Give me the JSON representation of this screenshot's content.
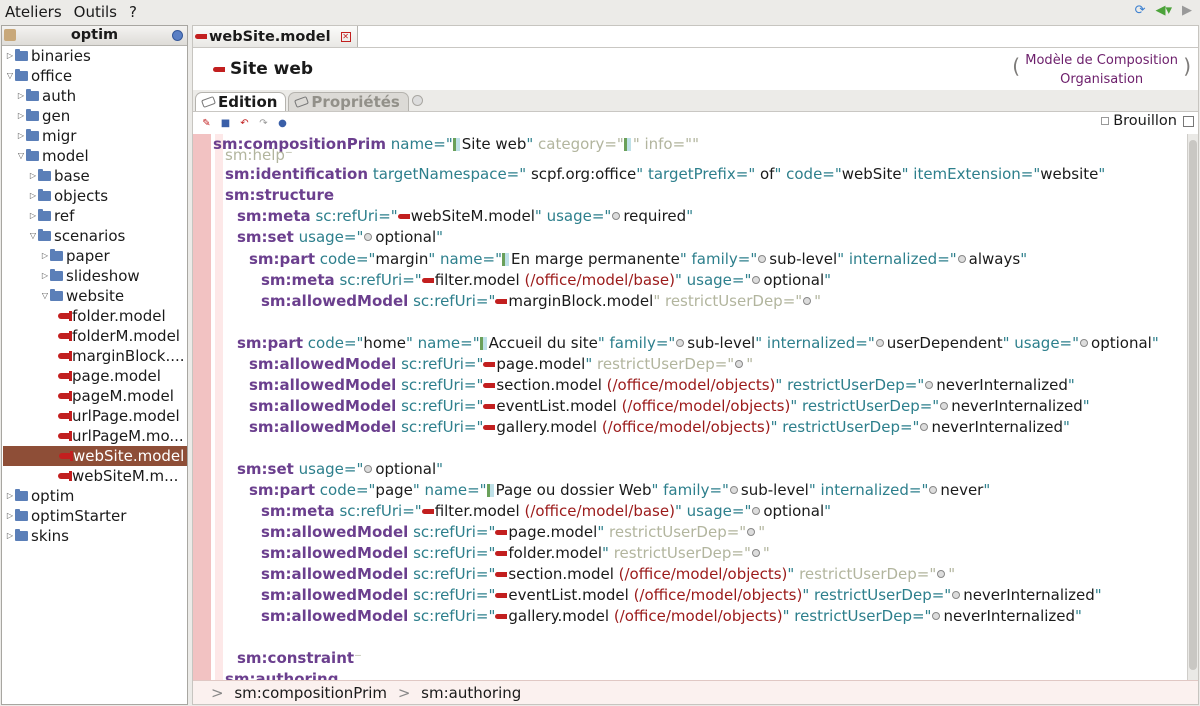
{
  "menu": [
    "Ateliers",
    "Outils",
    "?"
  ],
  "left_panel": {
    "title": "optim",
    "tree": [
      {
        "label": "binaries",
        "level": 0,
        "expanded": false,
        "kind": "folder"
      },
      {
        "label": "office",
        "level": 0,
        "expanded": true,
        "kind": "folder"
      },
      {
        "label": "auth",
        "level": 1,
        "expanded": false,
        "kind": "folder"
      },
      {
        "label": "gen",
        "level": 1,
        "expanded": false,
        "kind": "folder"
      },
      {
        "label": "migr",
        "level": 1,
        "expanded": false,
        "kind": "folder"
      },
      {
        "label": "model",
        "level": 1,
        "expanded": true,
        "kind": "folder"
      },
      {
        "label": "base",
        "level": 2,
        "expanded": false,
        "kind": "folder"
      },
      {
        "label": "objects",
        "level": 2,
        "expanded": false,
        "kind": "folder"
      },
      {
        "label": "ref",
        "level": 2,
        "expanded": false,
        "kind": "folder"
      },
      {
        "label": "scenarios",
        "level": 2,
        "expanded": true,
        "kind": "folder"
      },
      {
        "label": "paper",
        "level": 3,
        "expanded": false,
        "kind": "folder"
      },
      {
        "label": "slideshow",
        "level": 3,
        "expanded": false,
        "kind": "folder"
      },
      {
        "label": "website",
        "level": 3,
        "expanded": true,
        "kind": "folder"
      },
      {
        "label": "folder.model",
        "level": 4,
        "kind": "model"
      },
      {
        "label": "folderM.model",
        "level": 4,
        "kind": "model"
      },
      {
        "label": "marginBlock....",
        "level": 4,
        "kind": "model"
      },
      {
        "label": "page.model",
        "level": 4,
        "kind": "model"
      },
      {
        "label": "pageM.model",
        "level": 4,
        "kind": "model"
      },
      {
        "label": "urlPage.model",
        "level": 4,
        "kind": "model"
      },
      {
        "label": "urlPageM.mo...",
        "level": 4,
        "kind": "model"
      },
      {
        "label": "webSite.model",
        "level": 4,
        "kind": "model",
        "selected": true
      },
      {
        "label": "webSiteM.m...",
        "level": 4,
        "kind": "model"
      },
      {
        "label": "optim",
        "level": 0,
        "expanded": false,
        "kind": "folder"
      },
      {
        "label": "optimStarter",
        "level": 0,
        "expanded": false,
        "kind": "folder"
      },
      {
        "label": "skins",
        "level": 0,
        "expanded": false,
        "kind": "folder"
      }
    ]
  },
  "editor": {
    "tab_label": "webSite.model",
    "title": "Site web",
    "composition_line1": "Modèle de Composition",
    "composition_line2": "Organisation",
    "subtabs": [
      "Edition",
      "Propriétés"
    ],
    "brouillon": "Brouillon",
    "breadcrumb": [
      "sm:compositionPrim",
      "sm:authoring"
    ],
    "lines": {
      "l0_tag": "sm:compositionPrim",
      "l0_name": "Site web",
      "l1": "sm:help",
      "l2_tag": "sm:identification",
      "l2_ns": "scpf.org:office",
      "l2_prefix": "of",
      "l2_code": "webSite",
      "l2_ext": "website",
      "l3": "sm:structure",
      "l4_tag": "sm:meta",
      "l4_uri": "webSiteM.model",
      "l4_usage": "required",
      "l5_tag": "sm:set",
      "l5_usage": "optional",
      "l6_tag": "sm:part",
      "l6_code": "margin",
      "l6_name": "En marge permanente",
      "l6_family": "sub-level",
      "l6_int": "always",
      "l7_tag": "sm:meta",
      "l7_uri": "filter.model",
      "l7_path": "(/office/model/base)",
      "l7_usage": "optional",
      "l8_tag": "sm:allowedModel",
      "l8_uri": "marginBlock.model",
      "l9_tag": "sm:part",
      "l9_code": "home",
      "l9_name": "Accueil du site",
      "l9_family": "sub-level",
      "l9_int": "userDependent",
      "l9_usage": "optional",
      "l10_tag": "sm:allowedModel",
      "l10_uri": "page.model",
      "l11_tag": "sm:allowedModel",
      "l11_uri": "section.model",
      "l11_path": "(/office/model/objects)",
      "l11_dep": "neverInternalized",
      "l12_tag": "sm:allowedModel",
      "l12_uri": "eventList.model",
      "l12_path": "(/office/model/objects)",
      "l12_dep": "neverInternalized",
      "l13_tag": "sm:allowedModel",
      "l13_uri": "gallery.model",
      "l13_path": "(/office/model/objects)",
      "l13_dep": "neverInternalized",
      "l14_tag": "sm:set",
      "l14_usage": "optional",
      "l15_tag": "sm:part",
      "l15_code": "page",
      "l15_name": "Page ou dossier Web",
      "l15_family": "sub-level",
      "l15_int": "never",
      "l16_tag": "sm:meta",
      "l16_uri": "filter.model",
      "l16_path": "(/office/model/base)",
      "l16_usage": "optional",
      "l17_tag": "sm:allowedModel",
      "l17_uri": "page.model",
      "l18_tag": "sm:allowedModel",
      "l18_uri": "folder.model",
      "l19_tag": "sm:allowedModel",
      "l19_uri": "section.model",
      "l19_path": "(/office/model/objects)",
      "l20_tag": "sm:allowedModel",
      "l20_uri": "eventList.model",
      "l20_path": "(/office/model/objects)",
      "l20_dep": "neverInternalized",
      "l21_tag": "sm:allowedModel",
      "l21_uri": "gallery.model",
      "l21_path": "(/office/model/objects)",
      "l21_dep": "neverInternalized",
      "l22": "sm:constraint",
      "l23": "sm:authoring"
    }
  }
}
